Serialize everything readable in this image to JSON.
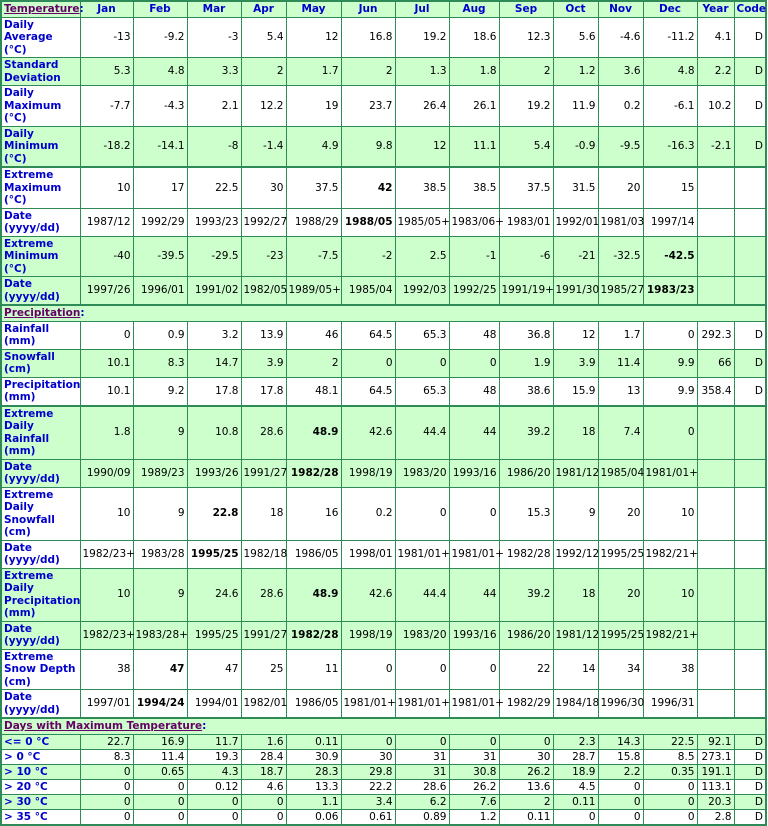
{
  "columns": [
    "Jan",
    "Feb",
    "Mar",
    "Apr",
    "May",
    "Jun",
    "Jul",
    "Aug",
    "Sep",
    "Oct",
    "Nov",
    "Dec",
    "Year",
    "Code"
  ],
  "sections": [
    {
      "title": "Temperature",
      "rows": [
        {
          "label": "Daily Average (°C)",
          "values": [
            "-13",
            "-9.2",
            "-3",
            "5.4",
            "12",
            "16.8",
            "19.2",
            "18.6",
            "12.3",
            "5.6",
            "-4.6",
            "-11.2",
            "4.1",
            "D"
          ],
          "bold": []
        },
        {
          "label": "Standard Deviation",
          "values": [
            "5.3",
            "4.8",
            "3.3",
            "2",
            "1.7",
            "2",
            "1.3",
            "1.8",
            "2",
            "1.2",
            "3.6",
            "4.8",
            "2.2",
            "D"
          ],
          "bold": []
        },
        {
          "label": "Daily Maximum (°C)",
          "values": [
            "-7.7",
            "-4.3",
            "2.1",
            "12.2",
            "19",
            "23.7",
            "26.4",
            "26.1",
            "19.2",
            "11.9",
            "0.2",
            "-6.1",
            "10.2",
            "D"
          ],
          "bold": []
        },
        {
          "label": "Daily Minimum (°C)",
          "values": [
            "-18.2",
            "-14.1",
            "-8",
            "-1.4",
            "4.9",
            "9.8",
            "12",
            "11.1",
            "5.4",
            "-0.9",
            "-9.5",
            "-16.3",
            "-2.1",
            "D"
          ],
          "bold": []
        },
        {
          "label": "Extreme Maximum (°C)",
          "values": [
            "10",
            "17",
            "22.5",
            "30",
            "37.5",
            "42",
            "38.5",
            "38.5",
            "37.5",
            "31.5",
            "20",
            "15",
            "",
            ""
          ],
          "bold": [
            5
          ]
        },
        {
          "label": "Date (yyyy/dd)",
          "values": [
            "1987/12",
            "1992/29",
            "1993/23",
            "1992/27",
            "1988/29",
            "1988/05",
            "1985/05+",
            "1983/06+",
            "1983/01",
            "1992/01",
            "1981/03",
            "1997/14",
            "",
            ""
          ],
          "bold": [
            5
          ]
        },
        {
          "label": "Extreme Minimum (°C)",
          "values": [
            "-40",
            "-39.5",
            "-29.5",
            "-23",
            "-7.5",
            "-2",
            "2.5",
            "-1",
            "-6",
            "-21",
            "-32.5",
            "-42.5",
            "",
            ""
          ],
          "bold": [
            11
          ]
        },
        {
          "label": "Date (yyyy/dd)",
          "values": [
            "1997/26",
            "1996/01",
            "1991/02",
            "1982/05",
            "1989/05+",
            "1985/04",
            "1992/03",
            "1992/25",
            "1991/19+",
            "1991/30",
            "1985/27",
            "1983/23",
            "",
            ""
          ],
          "bold": [
            11
          ]
        }
      ]
    },
    {
      "title": "Precipitation",
      "rows": [
        {
          "label": "Rainfall (mm)",
          "values": [
            "0",
            "0.9",
            "3.2",
            "13.9",
            "46",
            "64.5",
            "65.3",
            "48",
            "36.8",
            "12",
            "1.7",
            "0",
            "292.3",
            "D"
          ],
          "bold": []
        },
        {
          "label": "Snowfall (cm)",
          "values": [
            "10.1",
            "8.3",
            "14.7",
            "3.9",
            "2",
            "0",
            "0",
            "0",
            "1.9",
            "3.9",
            "11.4",
            "9.9",
            "66",
            "D"
          ],
          "bold": []
        },
        {
          "label": "Precipitation (mm)",
          "values": [
            "10.1",
            "9.2",
            "17.8",
            "17.8",
            "48.1",
            "64.5",
            "65.3",
            "48",
            "38.6",
            "15.9",
            "13",
            "9.9",
            "358.4",
            "D"
          ],
          "bold": []
        },
        {
          "label": "Extreme Daily Rainfall (mm)",
          "values": [
            "1.8",
            "9",
            "10.8",
            "28.6",
            "48.9",
            "42.6",
            "44.4",
            "44",
            "39.2",
            "18",
            "7.4",
            "0",
            "",
            ""
          ],
          "bold": [
            4
          ]
        },
        {
          "label": "Date (yyyy/dd)",
          "values": [
            "1990/09",
            "1989/23",
            "1993/26",
            "1991/27",
            "1982/28",
            "1998/19",
            "1983/20",
            "1993/16",
            "1986/20",
            "1981/12",
            "1985/04",
            "1981/01+",
            "",
            ""
          ],
          "bold": [
            4
          ]
        },
        {
          "label": "Extreme Daily Snowfall (cm)",
          "values": [
            "10",
            "9",
            "22.8",
            "18",
            "16",
            "0.2",
            "0",
            "0",
            "15.3",
            "9",
            "20",
            "10",
            "",
            ""
          ],
          "bold": [
            2
          ]
        },
        {
          "label": "Date (yyyy/dd)",
          "values": [
            "1982/23+",
            "1983/28",
            "1995/25",
            "1982/18",
            "1986/05",
            "1998/01",
            "1981/01+",
            "1981/01+",
            "1982/28",
            "1992/12",
            "1995/25",
            "1982/21+",
            "",
            ""
          ],
          "bold": [
            2
          ]
        },
        {
          "label": "Extreme Daily Precipitation (mm)",
          "values": [
            "10",
            "9",
            "24.6",
            "28.6",
            "48.9",
            "42.6",
            "44.4",
            "44",
            "39.2",
            "18",
            "20",
            "10",
            "",
            ""
          ],
          "bold": [
            4
          ]
        },
        {
          "label": "Date (yyyy/dd)",
          "values": [
            "1982/23+",
            "1983/28+",
            "1995/25",
            "1991/27",
            "1982/28",
            "1998/19",
            "1983/20",
            "1993/16",
            "1986/20",
            "1981/12",
            "1995/25",
            "1982/21+",
            "",
            ""
          ],
          "bold": [
            4
          ]
        },
        {
          "label": "Extreme Snow Depth (cm)",
          "values": [
            "38",
            "47",
            "47",
            "25",
            "11",
            "0",
            "0",
            "0",
            "22",
            "14",
            "34",
            "38",
            "",
            ""
          ],
          "bold": [
            1
          ]
        },
        {
          "label": "Date (yyyy/dd)",
          "values": [
            "1997/01",
            "1994/24",
            "1994/01",
            "1982/01",
            "1986/05",
            "1981/01+",
            "1981/01+",
            "1981/01+",
            "1982/29",
            "1984/18",
            "1996/30",
            "1996/31",
            "",
            ""
          ],
          "bold": [
            1
          ]
        }
      ]
    },
    {
      "title": "Days with Maximum Temperature",
      "rows": [
        {
          "label": "<= 0 °C",
          "values": [
            "22.7",
            "16.9",
            "11.7",
            "1.6",
            "0.11",
            "0",
            "0",
            "0",
            "0",
            "2.3",
            "14.3",
            "22.5",
            "92.1",
            "D"
          ],
          "bold": []
        },
        {
          "label": "> 0 °C",
          "values": [
            "8.3",
            "11.4",
            "19.3",
            "28.4",
            "30.9",
            "30",
            "31",
            "31",
            "30",
            "28.7",
            "15.8",
            "8.5",
            "273.1",
            "D"
          ],
          "bold": []
        },
        {
          "label": "> 10 °C",
          "values": [
            "0",
            "0.65",
            "4.3",
            "18.7",
            "28.3",
            "29.8",
            "31",
            "30.8",
            "26.2",
            "18.9",
            "2.2",
            "0.35",
            "191.1",
            "D"
          ],
          "bold": []
        },
        {
          "label": "> 20 °C",
          "values": [
            "0",
            "0",
            "0.12",
            "4.6",
            "13.3",
            "22.2",
            "28.6",
            "26.2",
            "13.6",
            "4.5",
            "0",
            "0",
            "113.1",
            "D"
          ],
          "bold": []
        },
        {
          "label": "> 30 °C",
          "values": [
            "0",
            "0",
            "0",
            "0",
            "1.1",
            "3.4",
            "6.2",
            "7.6",
            "2",
            "0.11",
            "0",
            "0",
            "20.3",
            "D"
          ],
          "bold": []
        },
        {
          "label": "> 35 °C",
          "values": [
            "0",
            "0",
            "0",
            "0",
            "0.06",
            "0.61",
            "0.89",
            "1.2",
            "0.11",
            "0",
            "0",
            "0",
            "2.8",
            "D"
          ],
          "bold": []
        }
      ]
    }
  ]
}
